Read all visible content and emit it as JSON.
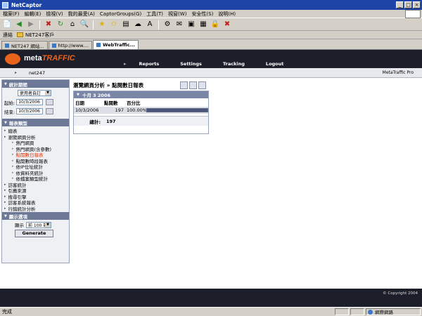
{
  "window": {
    "title": "NetCaptor"
  },
  "menu": [
    "檔案(F)",
    "編輯(E)",
    "檢視(V)",
    "我的最愛(A)",
    "CaptorGroups(G)",
    "工具(T)",
    "視窗(W)",
    "安全性(S)",
    "說明(H)"
  ],
  "links": {
    "label": "連結",
    "item": "NET247客戶"
  },
  "tabs": [
    {
      "label": "NET247 網站..."
    },
    {
      "label": "http://www...."
    },
    {
      "label": "WebTraffic..."
    }
  ],
  "header": {
    "logo_meta": "meta",
    "logo_traffic": "TRAFFIC",
    "nav": [
      "Reports",
      "Settings",
      "Tracking",
      "Logout"
    ]
  },
  "subheader": {
    "site": "net247",
    "product": "MetaTraffic Pro"
  },
  "sidebar": {
    "stats_period": {
      "title": "統計期間",
      "period": "使用者自訂",
      "start_label": "起始:",
      "start_date": "10/3/2006",
      "end_label": "結束:",
      "end_date": "10/3/2006"
    },
    "report_types": {
      "title": "報表類型",
      "items": [
        {
          "label": "總表",
          "level": 0
        },
        {
          "label": "瀏覽網頁分析",
          "level": 0
        },
        {
          "label": "熱門網頁",
          "level": 1
        },
        {
          "label": "熱門網頁(含參數)",
          "level": 1
        },
        {
          "label": "點閱數日報表",
          "level": 1,
          "active": true
        },
        {
          "label": "點閱數時段報表",
          "level": 1
        },
        {
          "label": "依IP位址統計",
          "level": 1
        },
        {
          "label": "依資料夾統計",
          "level": 1
        },
        {
          "label": "依檔案類型統計",
          "level": 1
        },
        {
          "label": "訪客統計",
          "level": 0
        },
        {
          "label": "引薦來源",
          "level": 0
        },
        {
          "label": "搜尋引擎",
          "level": 0
        },
        {
          "label": "訪客系統報表",
          "level": 0
        },
        {
          "label": "行銷統計分析",
          "level": 0
        }
      ]
    },
    "display": {
      "title": "顯示選項",
      "show_label": "顯示",
      "show_value": "前 100 筆",
      "generate": "Generate"
    }
  },
  "report": {
    "title": "瀏覽網頁分析 » 點閱數日報表",
    "band": "十月 3 2006",
    "columns": [
      "日期",
      "點閱數",
      "百分比"
    ],
    "rows": [
      {
        "date": "10/3/2006",
        "hits": "197",
        "percent": "100.00%",
        "fraction": 1.0
      }
    ],
    "total_label": "總計:",
    "total_value": "197"
  },
  "footer": {
    "copyright": "© Copyright 2004"
  },
  "status": {
    "text": "完成",
    "zone": "網際網路"
  },
  "colors": {
    "header_bg": "#1c1f2a",
    "accent_orange": "#e8641c",
    "active_link": "#e03a10",
    "panel_band": "#7a86a6"
  }
}
